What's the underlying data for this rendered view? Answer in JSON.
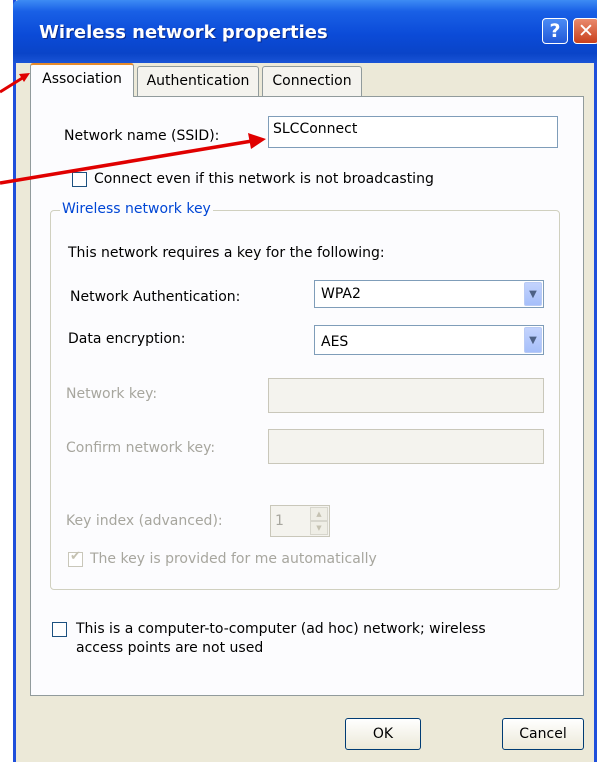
{
  "window": {
    "title": "Wireless network properties",
    "help_glyph": "?",
    "close_glyph": "✕"
  },
  "tabs": [
    {
      "label": "Association",
      "active": true
    },
    {
      "label": "Authentication",
      "active": false
    },
    {
      "label": "Connection",
      "active": false
    }
  ],
  "association": {
    "ssid_label": "Network name (SSID):",
    "ssid_value": "SLCConnect",
    "broadcast_checkbox_label": "Connect even if this network is not broadcasting",
    "broadcast_checked": false
  },
  "key_group": {
    "legend": "Wireless network key",
    "intro": "This network requires a key for the following:",
    "auth_label": "Network Authentication:",
    "auth_value": "WPA2",
    "encryption_label": "Data encryption:",
    "encryption_value": "AES",
    "network_key_label": "Network key:",
    "network_key_value": "",
    "confirm_key_label": "Confirm network key:",
    "confirm_key_value": "",
    "key_index_label": "Key index (advanced):",
    "key_index_value": "1",
    "auto_key_label": "The key is provided for me automatically",
    "auto_key_checked": true
  },
  "adhoc": {
    "label_line1": "This is a computer-to-computer (ad hoc) network; wireless",
    "label_line2": "access points are not used",
    "checked": false
  },
  "buttons": {
    "ok": "OK",
    "cancel": "Cancel"
  },
  "colors": {
    "titlebar": "#0a44c8",
    "annotation_arrow": "#e00000",
    "group_legend": "#0046d5"
  }
}
